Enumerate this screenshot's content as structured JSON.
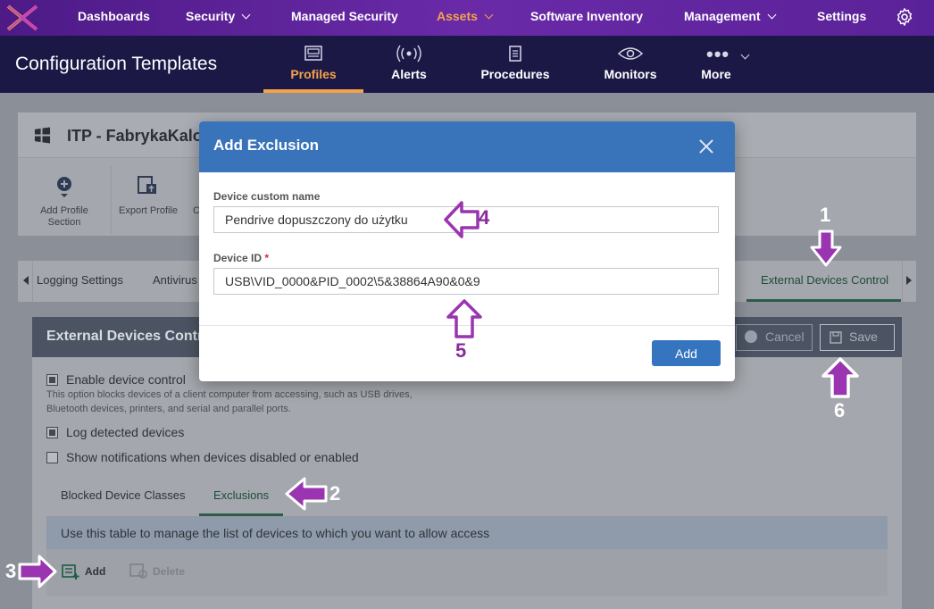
{
  "topnav": {
    "items": [
      {
        "label": "Dashboards",
        "has_dropdown": false
      },
      {
        "label": "Security",
        "has_dropdown": true
      },
      {
        "label": "Managed Security",
        "has_dropdown": false
      },
      {
        "label": "Assets",
        "has_dropdown": true,
        "active": true
      },
      {
        "label": "Software Inventory",
        "has_dropdown": false
      },
      {
        "label": "Management",
        "has_dropdown": true
      },
      {
        "label": "Settings",
        "has_dropdown": false
      }
    ],
    "settings_icon": "gear-icon",
    "logo_icon": "brand-logo-icon"
  },
  "header": {
    "title": "Configuration Templates",
    "tabs": [
      {
        "label": "Profiles",
        "icon": "profiles-icon",
        "active": true
      },
      {
        "label": "Alerts",
        "icon": "alerts-icon"
      },
      {
        "label": "Procedures",
        "icon": "procedures-icon"
      },
      {
        "label": "Monitors",
        "icon": "monitors-icon"
      },
      {
        "label": "More",
        "icon": "more-dots-icon",
        "has_dropdown": true
      }
    ]
  },
  "profile": {
    "name": "ITP - FabrykaKalos",
    "os_icon": "windows-icon",
    "toolbar": {
      "add_section": "Add Profile Section",
      "export": "Export Profile",
      "c_partial": "C"
    },
    "section_tabs": [
      "Logging Settings",
      "Antivirus",
      "External Devices Control"
    ],
    "active_section": "External Devices Control"
  },
  "edc_panel": {
    "title": "External Devices Control",
    "cancel_label": "Cancel",
    "save_label": "Save",
    "enable_label": "Enable device control",
    "enable_desc_1": "This option blocks devices of a client computer from accessing, such as USB drives,",
    "enable_desc_2": "Bluetooth devices, printers, and serial and parallel ports.",
    "log_label": "Log detected devices",
    "notify_label": "Show notifications when devices disabled or enabled",
    "enable_checked": true,
    "log_checked": true,
    "notify_checked": false,
    "subtabs": [
      "Blocked Device Classes",
      "Exclusions"
    ],
    "active_subtab": "Exclusions",
    "info_text": "Use this table to manage the list of devices to which you want to allow access",
    "add_label": "Add",
    "delete_label": "Delete"
  },
  "modal": {
    "title": "Add Exclusion",
    "name_label": "Device custom name",
    "name_value": "Pendrive dopuszczony do użytku",
    "id_label": "Device ID",
    "id_required": "*",
    "id_value": "USB\\VID_0000&PID_0002\\5&38864A90&0&9",
    "add_button": "Add"
  },
  "annotations": {
    "color": "#9a34b0",
    "numbers": [
      "1",
      "2",
      "3",
      "4",
      "5",
      "6"
    ]
  }
}
